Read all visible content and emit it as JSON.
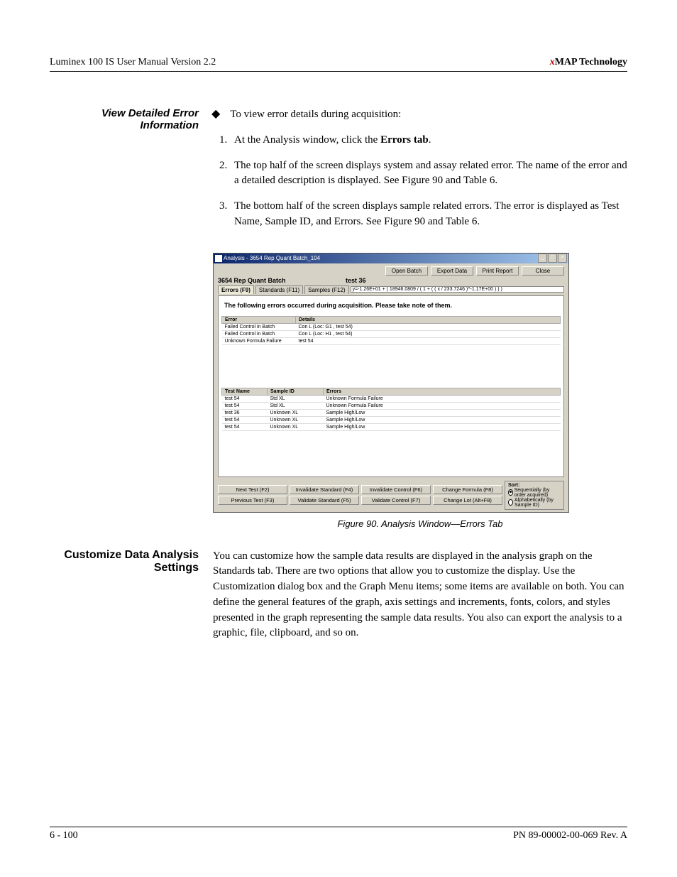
{
  "header": {
    "left": "Luminex 100 IS User Manual Version 2.2",
    "right_x": "x",
    "right_tech": "MAP Technology"
  },
  "section1": {
    "sidehead": "View Detailed Error Information",
    "intro": "To view error details during acquisition:",
    "steps": [
      "At the Analysis window, click the Errors tab.",
      "The top half of the screen displays system and assay related error. The name of the error and a detailed description is displayed. See Figure 90 and Table 6.",
      "The bottom half of the screen displays sample related errors. The error is displayed as Test Name, Sample ID, and Errors. See Figure 90 and Table 6."
    ],
    "step1_bold": "Errors tab"
  },
  "figure": {
    "caption": "Figure 90.  Analysis Window—Errors Tab"
  },
  "win": {
    "title": "Analysis - 3654 Rep Quant Batch_104",
    "buttons_top": {
      "open": "Open Batch",
      "export": "Export Data",
      "print": "Print Report",
      "close": "Close"
    },
    "batch_label": "3654 Rep Quant Batch",
    "test_label": "test 36",
    "tabs": {
      "errors": "Errors (F9)",
      "standards": "Standards (F11)",
      "samples": "Samples (F12)"
    },
    "formula": "y=-1.26E+01 + ( 18946.0809 / ( 1 + ( ( x / 233.7246 )^-1.17E+00 ) ) )",
    "error_heading": "The following errors occurred during acquisition.  Please take note of them.",
    "top_table": {
      "headers": {
        "error": "Error",
        "details": "Details"
      },
      "rows": [
        {
          "error": "Failed Control in Batch",
          "details": "Con L (Loc: G1 , test 54)"
        },
        {
          "error": "Failed Control in Batch",
          "details": "Con L (Loc: H1 , test 54)"
        },
        {
          "error": "Unknown Formula Failure",
          "details": "test 54"
        }
      ]
    },
    "bottom_table": {
      "headers": {
        "testname": "Test Name",
        "sampleid": "Sample ID",
        "errors": "Errors"
      },
      "rows": [
        {
          "tn": "test 54",
          "sid": "Std XL",
          "err": "Unknown Formula Failure"
        },
        {
          "tn": "test 54",
          "sid": "Std XL",
          "err": "Unknown Formula Failure"
        },
        {
          "tn": "test 36",
          "sid": "Unknown XL",
          "err": "Sample High/Low"
        },
        {
          "tn": "test 54",
          "sid": "Unknown XL",
          "err": "Sample High/Low"
        },
        {
          "tn": "test 54",
          "sid": "Unknown XL",
          "err": "Sample High/Low"
        }
      ]
    },
    "buttons_bottom": {
      "next": "Next Test (F2)",
      "prev": "Previous Test (F3)",
      "invstd": "Invalidate Standard (F4)",
      "valstd": "Validate Standard (F5)",
      "invctrl": "Invalidate Control (F6)",
      "valctrl": "Validate Control (F7)",
      "chgform": "Change Formula (F8)",
      "chglot": "Change Lot (Alt+F8)"
    },
    "sort": {
      "legend": "Sort:",
      "opt1": "Sequentially (by order acquired)",
      "opt2": "Alphabetically (by Sample ID)"
    }
  },
  "section2": {
    "sidehead": "Customize Data Analysis Settings",
    "body": "You can customize how the sample data results are displayed in the analysis graph on the Standards tab. There are two options that allow you to customize the display. Use the Customization dialog box and the Graph Menu items; some items are available on both. You can define the general features of the graph, axis settings and increments, fonts, colors, and styles presented in the graph representing the sample data results. You also can export the analysis to a graphic, file, clipboard, and so on."
  },
  "footer": {
    "left": "6 - 100",
    "right": "PN 89-00002-00-069 Rev. A"
  }
}
